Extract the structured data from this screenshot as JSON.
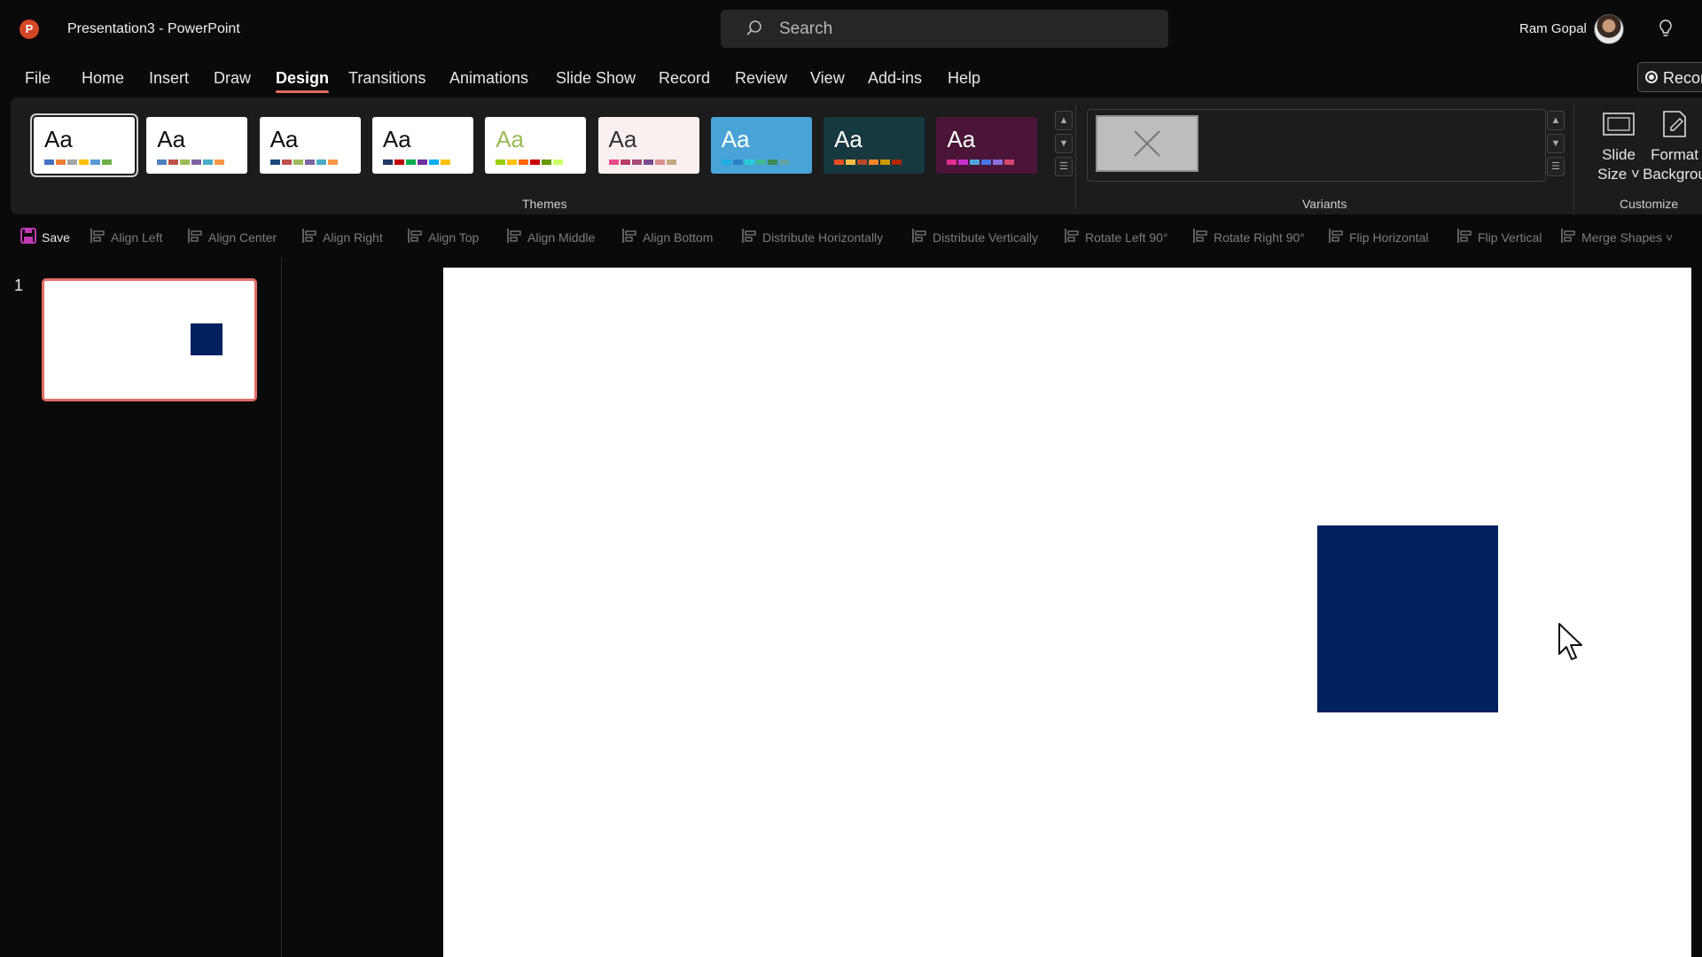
{
  "titlebar": {
    "logo_letter": "P",
    "doc_title": "Presentation3  -  PowerPoint",
    "search_placeholder": "Search",
    "user_name": "Ram Gopal"
  },
  "menu": {
    "tabs": [
      "File",
      "Home",
      "Insert",
      "Draw",
      "Design",
      "Transitions",
      "Animations",
      "Slide Show",
      "Record",
      "Review",
      "View",
      "Add-ins",
      "Help"
    ],
    "active_tab": "Design",
    "record_label": "Recor"
  },
  "ribbon": {
    "themes_label": "Themes",
    "variants_label": "Variants",
    "customize_label": "Customize",
    "theme_glyph": "Aa",
    "slide_size": [
      "Slide",
      "Size ˅"
    ],
    "format_background": [
      "Format",
      "Backgrou"
    ]
  },
  "themes": [
    {
      "bg": "#ffffff",
      "text": "#111111",
      "bars": [
        "#4472c4",
        "#ed7d31",
        "#a5a5a5",
        "#ffc000",
        "#5b9bd5",
        "#70ad47"
      ]
    },
    {
      "bg": "#ffffff",
      "text": "#111111",
      "bars": [
        "#4f81bd",
        "#c0504d",
        "#9bbb59",
        "#8064a2",
        "#4bacc6",
        "#f79646"
      ]
    },
    {
      "bg": "#ffffff",
      "text": "#111111",
      "bars": [
        "#1f497d",
        "#c0504d",
        "#9bbb59",
        "#8064a2",
        "#4bacc6",
        "#f79646"
      ]
    },
    {
      "bg": "#ffffff",
      "text": "#111111",
      "bars": [
        "#1f3864",
        "#c00000",
        "#00b050",
        "#7030a0",
        "#00b0f0",
        "#ffc000"
      ]
    },
    {
      "bg": "#ffffff",
      "text": "#9bbb59",
      "bars": [
        "#99cc00",
        "#ffc000",
        "#ff6600",
        "#cc0000",
        "#669900",
        "#ccff66"
      ]
    },
    {
      "bg": "#fbf0f0",
      "text": "#333333",
      "bars": [
        "#e84c8b",
        "#b83d68",
        "#a64d79",
        "#7b4a91",
        "#d98e8e",
        "#c5a880"
      ]
    },
    {
      "bg": "#4aa3d6",
      "text": "#ffffff",
      "bars": [
        "#1cade4",
        "#2683c6",
        "#27ced7",
        "#42ba97",
        "#3e8853",
        "#62a39f"
      ]
    },
    {
      "bg": "#16393f",
      "text": "#ffffff",
      "bars": [
        "#e84c22",
        "#ffbd47",
        "#b64926",
        "#ff8427",
        "#cc9900",
        "#b22600"
      ]
    },
    {
      "bg": "#4a1537",
      "text": "#ffffff",
      "bars": [
        "#e32d91",
        "#c830cc",
        "#4ea6dc",
        "#4775e7",
        "#8971e1",
        "#d54773"
      ]
    }
  ],
  "toolbar": {
    "items": [
      {
        "label": "Save",
        "enabled": true
      },
      {
        "label": "Align Left",
        "enabled": false
      },
      {
        "label": "Align Center",
        "enabled": false
      },
      {
        "label": "Align Right",
        "enabled": false
      },
      {
        "label": "Align Top",
        "enabled": false
      },
      {
        "label": "Align Middle",
        "enabled": false
      },
      {
        "label": "Align Bottom",
        "enabled": false
      },
      {
        "label": "Distribute Horizontally",
        "enabled": false
      },
      {
        "label": "Distribute Vertically",
        "enabled": false
      },
      {
        "label": "Rotate Left 90°",
        "enabled": false
      },
      {
        "label": "Rotate Right 90°",
        "enabled": false
      },
      {
        "label": "Flip Horizontal",
        "enabled": false
      },
      {
        "label": "Flip Vertical",
        "enabled": false
      },
      {
        "label": "Merge Shapes ˅",
        "enabled": false
      }
    ]
  },
  "slides": {
    "number": "1"
  },
  "colors": {
    "accent": "#e06c5c",
    "shape_fill": "#002060",
    "save_icon": "#c239b3"
  }
}
